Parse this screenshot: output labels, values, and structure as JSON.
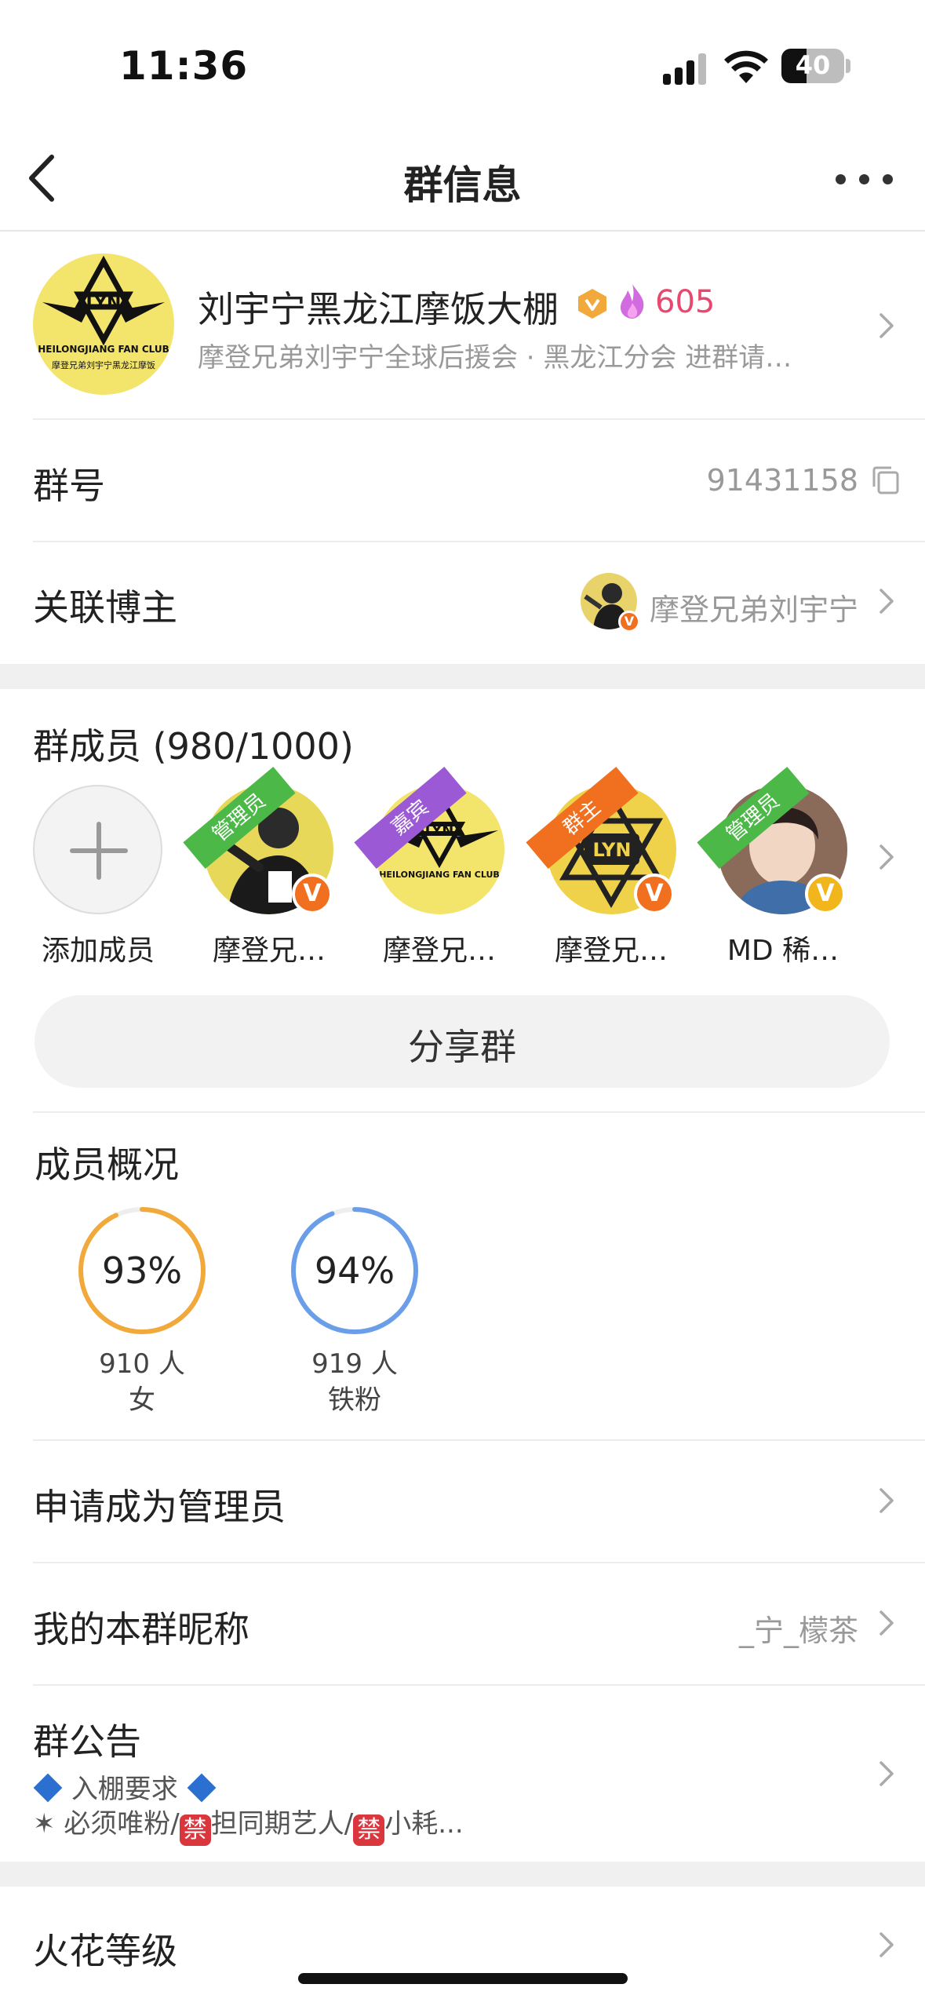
{
  "status_bar": {
    "time": "11:36",
    "battery": "40"
  },
  "nav": {
    "title": "群信息"
  },
  "group": {
    "name": "刘宇宁黑龙江摩饭大棚",
    "spark_count": "605",
    "description": "摩登兄弟刘宇宁全球后援会 · 黑龙江分会 进群请…",
    "avatar_text": "LYN",
    "avatar_caption": "HEILONGJIANG FAN CLUB",
    "avatar_caption2": "摩登兄弟刘宇宁黑龙江摩饭"
  },
  "group_number": {
    "label": "群号",
    "value": "91431158"
  },
  "linked_blogger": {
    "label": "关联博主",
    "value": "摩登兄弟刘宇宁"
  },
  "members": {
    "title": "群成员 (980/1000)",
    "add_label": "添加成员",
    "items": [
      {
        "name": "摩登兄…",
        "role": "管理员",
        "role_color": "#4cb848",
        "v_color": "#f07020"
      },
      {
        "name": "摩登兄…",
        "role": "嘉宾",
        "role_color": "#9b59d6",
        "v_color": "#f07020"
      },
      {
        "name": "摩登兄…",
        "role": "群主",
        "role_color": "#f07020",
        "v_color": "#f07020"
      },
      {
        "name": "MD 稀…",
        "role": "管理员",
        "role_color": "#4cb848",
        "v_color": "#f2b61d"
      }
    ]
  },
  "share": {
    "label": "分享群"
  },
  "overview": {
    "title": "成员概况",
    "stats": [
      {
        "percent_text": "93%",
        "fraction": 0.93,
        "count": "910 人",
        "caption": "女",
        "color": "#f2a93b"
      },
      {
        "percent_text": "94%",
        "fraction": 0.94,
        "count": "919 人",
        "caption": "铁粉",
        "color": "#6b9ee8"
      }
    ]
  },
  "apply_admin": {
    "label": "申请成为管理员"
  },
  "nickname": {
    "label": "我的本群昵称",
    "value": "_宁_檬茶"
  },
  "notice": {
    "label": "群公告",
    "line1": "入棚要求",
    "line2_a": "✶ 必须唯粉/",
    "forbid": "禁",
    "line2_b": "担同期艺人/",
    "line2_c": "小耗..."
  },
  "spark_level": {
    "label": "火花等级"
  }
}
